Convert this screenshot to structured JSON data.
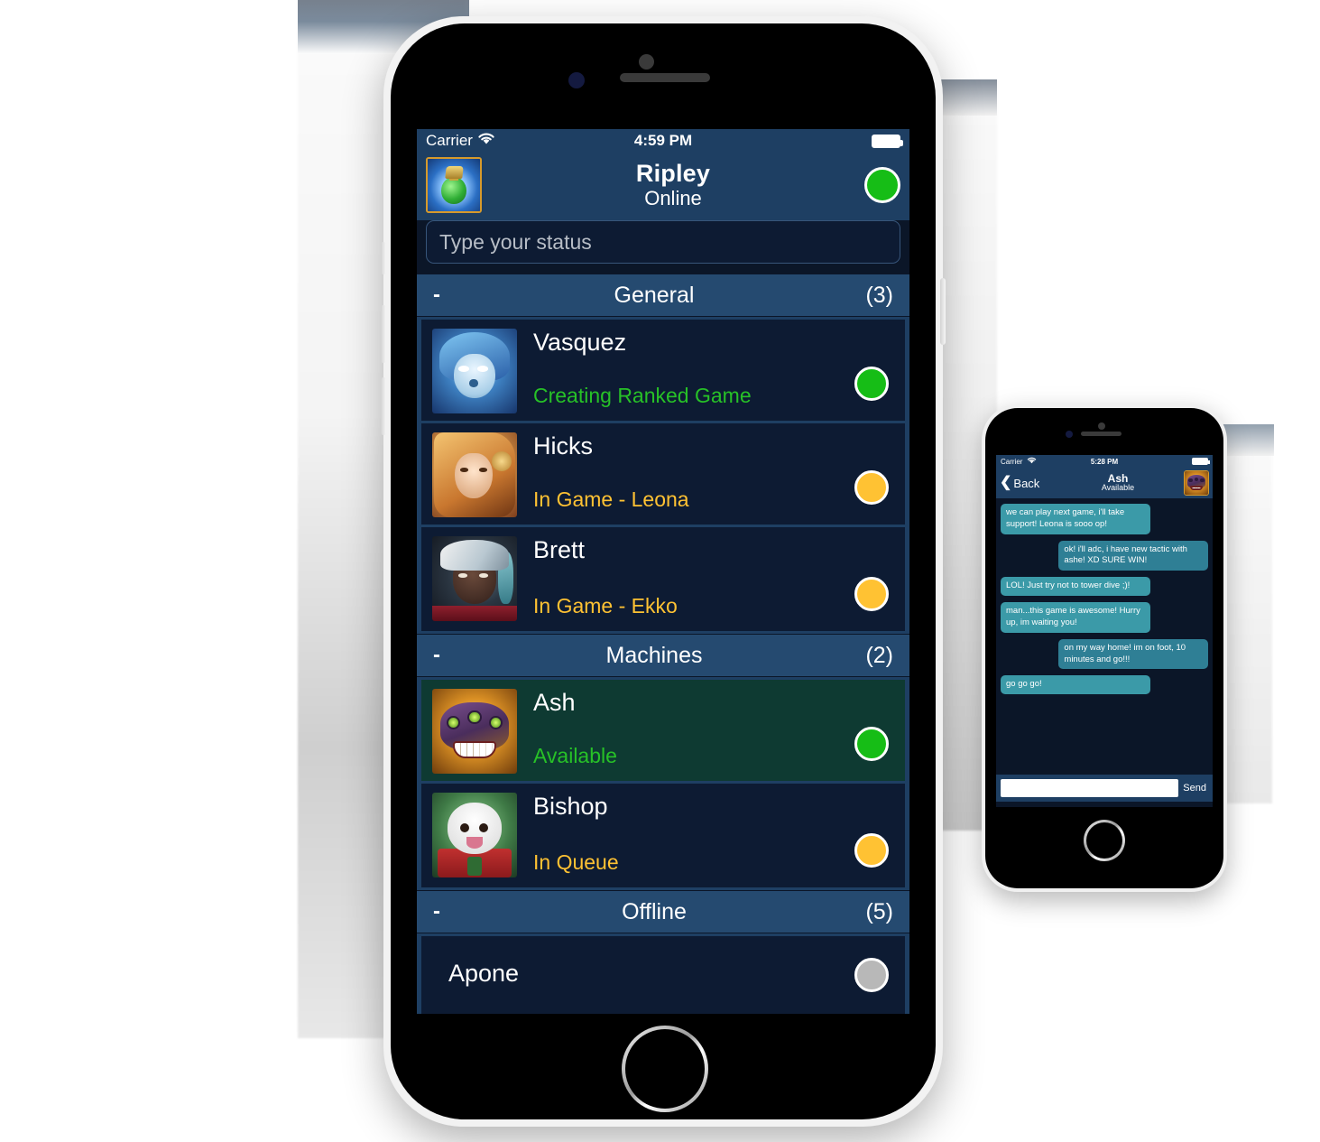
{
  "colors": {
    "header_blue": "#1e3f63",
    "group_blue": "#254a70",
    "row_dark": "#0d1b33",
    "row_selected": "#0e3a32",
    "green": "#16bd16",
    "amber": "#ffc233",
    "grey": "#b8b8b8",
    "status_green_text": "#27c127",
    "bubble_them": "#3b9aa8",
    "bubble_me": "#2f7f95"
  },
  "main_phone": {
    "status_bar": {
      "carrier": "Carrier",
      "wifi_icon": "wifi-icon",
      "time": "4:59 PM",
      "battery_icon": "battery-full-icon"
    },
    "header": {
      "avatar_icon": "potion-avatar",
      "name": "Ripley",
      "presence": "Online",
      "presence_dot": "green"
    },
    "status_input": {
      "placeholder": "Type your status",
      "value": ""
    },
    "groups": [
      {
        "toggle": "-",
        "title": "General",
        "count": "(3)",
        "friends": [
          {
            "avatar_icon": "ghost-avatar",
            "name": "Vasquez",
            "status": "Creating Ranked Game",
            "status_color": "green",
            "dot": "green",
            "selected": false
          },
          {
            "avatar_icon": "leona-avatar",
            "name": "Hicks",
            "status": "In Game - Leona",
            "status_color": "amber",
            "dot": "amber",
            "selected": false
          },
          {
            "avatar_icon": "ekko-avatar",
            "name": "Brett",
            "status": "In Game - Ekko",
            "status_color": "amber",
            "dot": "amber",
            "selected": false
          }
        ]
      },
      {
        "toggle": "-",
        "title": "Machines",
        "count": "(2)",
        "friends": [
          {
            "avatar_icon": "ash-mask-avatar",
            "name": "Ash",
            "status": "Available",
            "status_color": "green",
            "dot": "green",
            "selected": true
          },
          {
            "avatar_icon": "poro-avatar",
            "name": "Bishop",
            "status": "In Queue",
            "status_color": "amber",
            "dot": "amber",
            "selected": false
          }
        ]
      },
      {
        "toggle": "-",
        "title": "Offline",
        "count": "(5)",
        "friends": [
          {
            "avatar_icon": "",
            "name": "Apone",
            "status": "",
            "status_color": "",
            "dot": "grey",
            "selected": false,
            "simple": true
          }
        ]
      }
    ]
  },
  "chat_phone": {
    "status_bar": {
      "carrier": "Carrier",
      "wifi_icon": "wifi-icon",
      "time": "5:28 PM",
      "battery_icon": "battery-full-icon"
    },
    "header": {
      "back_label": "Back",
      "back_icon": "chevron-left-icon",
      "name": "Ash",
      "presence": "Available",
      "avatar_icon": "ash-mask-avatar"
    },
    "messages": [
      {
        "from": "them",
        "text": "we can play next game, i'll take support! Leona is sooo op!"
      },
      {
        "from": "me",
        "text": "ok! i'll adc, i have new tactic with ashe! XD SURE WIN!"
      },
      {
        "from": "them",
        "text": "LOL! Just try not to tower dive ;)!"
      },
      {
        "from": "them",
        "text": "man...this game is awesome! Hurry up, im waiting you!"
      },
      {
        "from": "me",
        "text": "on my way home! im on foot, 10 minutes and go!!!"
      },
      {
        "from": "them",
        "text": "go go go!"
      }
    ],
    "composer": {
      "placeholder": "",
      "value": "",
      "send_label": "Send"
    }
  }
}
